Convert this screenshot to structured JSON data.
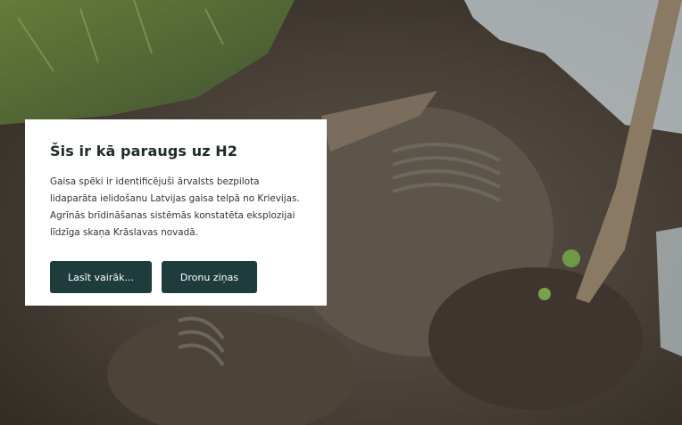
{
  "hero": {
    "image_description": "drone-engine-wreckage-in-mud"
  },
  "card": {
    "title": "Šis ir kā paraugs uz H2",
    "text": "Gaisa spēki ir identificējuši ārvalsts bezpilota lidaparāta ielidošanu Latvijas gaisa telpā no Krievijas.  Agrīnās brīdināšanas sistēmās konstatēta eksplozijai līdzīga skaņa Krāslavas novadā.",
    "buttons": {
      "read_more": "Lasīt vairāk...",
      "drone_news": "Dronu ziņas"
    }
  },
  "colors": {
    "button_bg": "#1f3c3d",
    "card_bg": "#ffffff",
    "title": "#1e2b2b"
  }
}
